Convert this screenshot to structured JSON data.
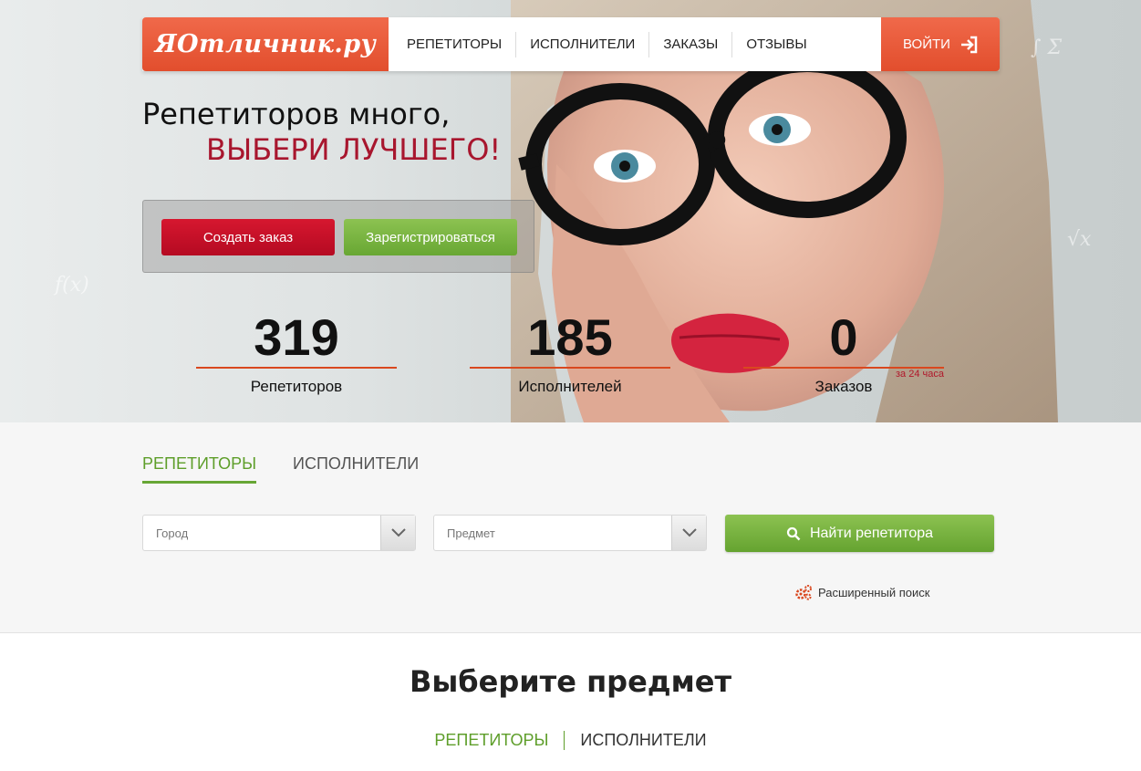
{
  "header": {
    "logo_text": "ЯОтличник.ру",
    "nav": [
      "РЕПЕТИТОРЫ",
      "ИСПОЛНИТЕЛИ",
      "ЗАКАЗЫ",
      "ОТЗЫВЫ"
    ],
    "login_label": "ВОЙТИ"
  },
  "hero": {
    "headline_line1": "Репетиторов много,",
    "headline_line2": "ВЫБЕРИ ЛУЧШЕГО!",
    "create_order_label": "Создать заказ",
    "register_label": "Зарегистрироваться",
    "stats": [
      {
        "value": "319",
        "label": "Репетиторов"
      },
      {
        "value": "185",
        "label": "Исполнителей"
      },
      {
        "value": "0",
        "label": "Заказов",
        "note": "за 24 часа"
      }
    ]
  },
  "search": {
    "tabs": [
      "РЕПЕТИТОРЫ",
      "ИСПОЛНИТЕЛИ"
    ],
    "active_tab": 0,
    "city_placeholder": "Город",
    "subject_placeholder": "Предмет",
    "find_label": "Найти репетитора",
    "advanced_label": "Расширенный поиск"
  },
  "subjects": {
    "title": "Выберите предмет",
    "tabs": [
      "РЕПЕТИТОРЫ",
      "ИСПОЛНИТЕЛИ"
    ]
  },
  "colors": {
    "brand_orange": "#e24e2d",
    "accent_red": "#b50a22",
    "accent_green": "#68a733",
    "headline_red": "#a8162e"
  }
}
